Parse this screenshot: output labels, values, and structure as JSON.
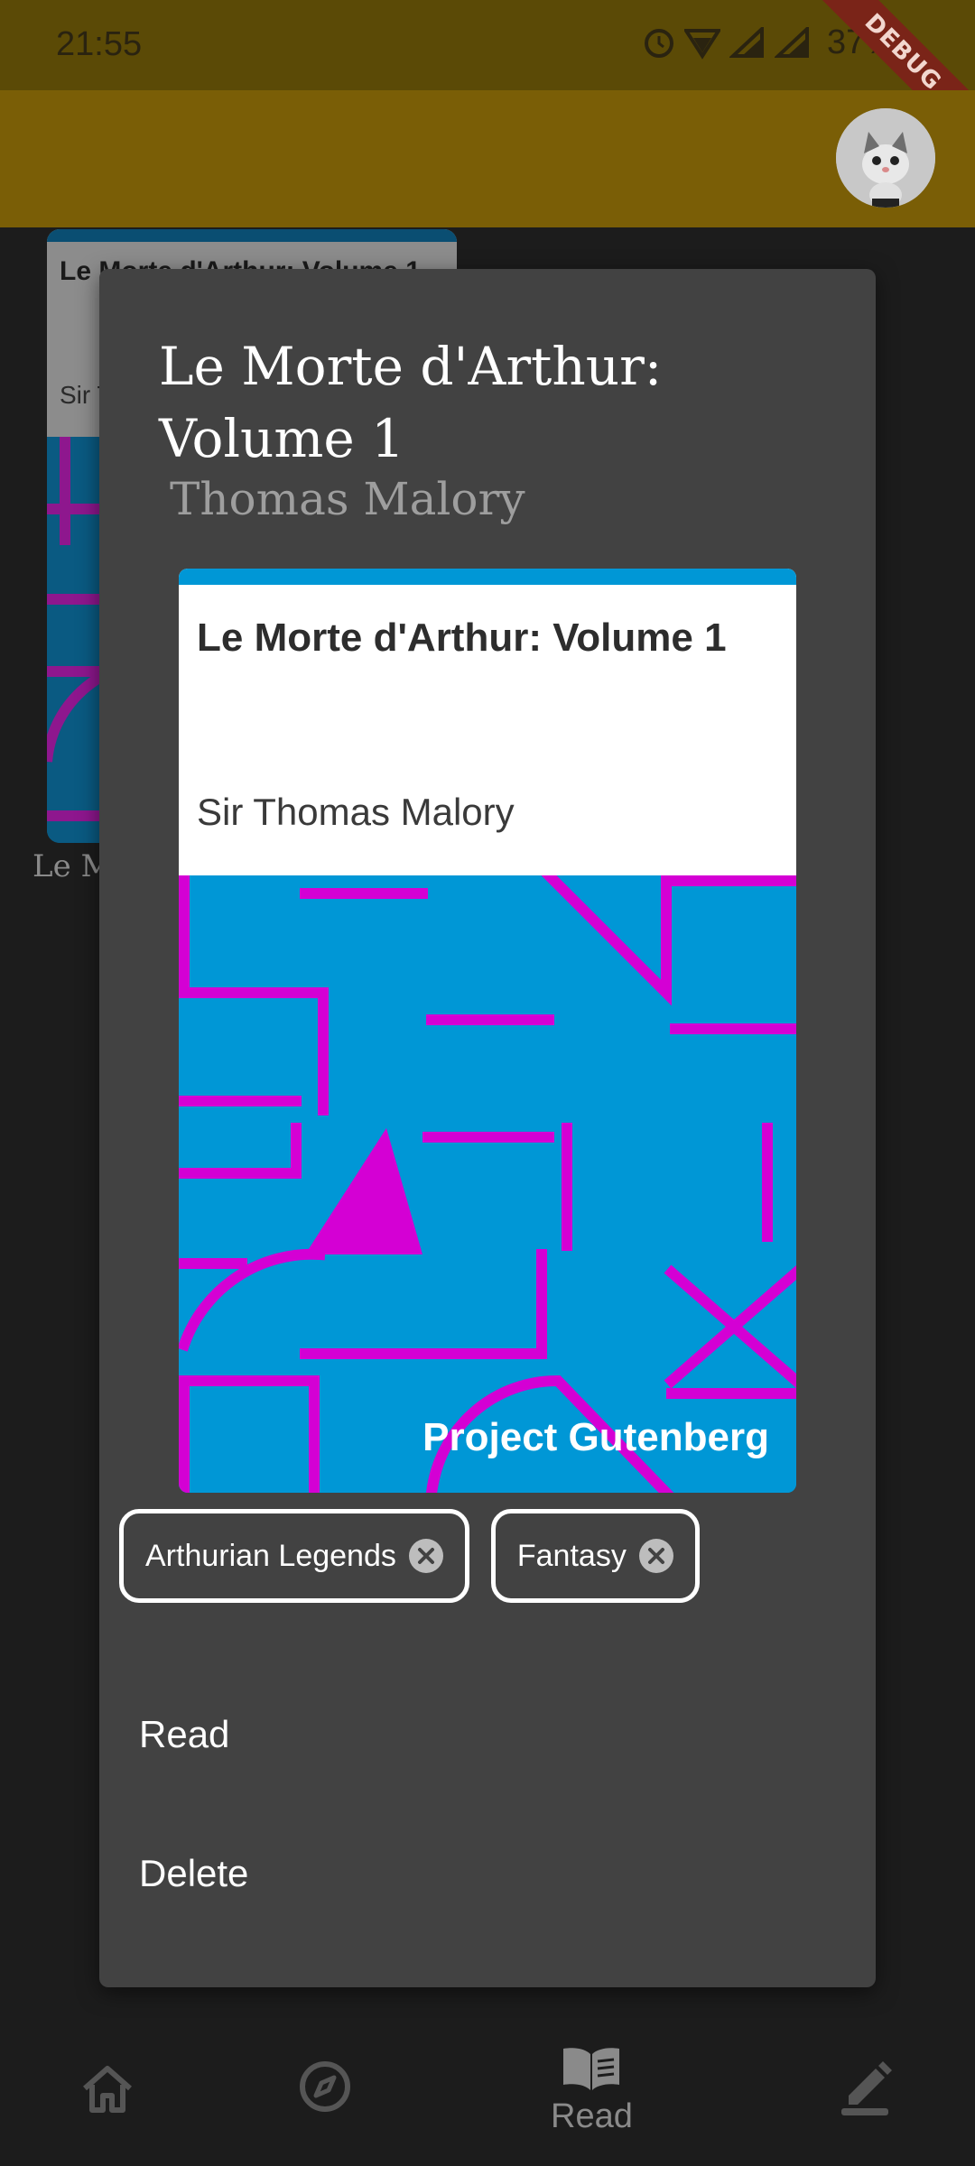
{
  "status_bar": {
    "time": "21:55",
    "battery": "37%",
    "debug_label": "DEBUG"
  },
  "background_card": {
    "cover_title": "Le Morte d'Arthur: Volume 1",
    "cover_author": "Sir Thomas Malory",
    "caption": "Le M"
  },
  "dialog": {
    "title": "Le Morte d'Arthur: Volume 1",
    "author": "Thomas Malory",
    "cover": {
      "title": "Le Morte d'Arthur: Volume 1",
      "author": "Sir Thomas Malory",
      "publisher": "Project Gutenberg"
    },
    "tags": [
      {
        "label": "Arthurian Legends"
      },
      {
        "label": "Fantasy"
      }
    ],
    "actions": {
      "read": "Read",
      "delete": "Delete"
    }
  },
  "bottom_nav": {
    "items": [
      {
        "icon": "home-icon",
        "label": ""
      },
      {
        "icon": "compass-icon",
        "label": ""
      },
      {
        "icon": "book-open-icon",
        "label": "Read"
      },
      {
        "icon": "edit-icon",
        "label": ""
      }
    ]
  },
  "colors": {
    "status_bar": "#5b4a06",
    "app_bar": "#7a5e06",
    "dialog": "#424242",
    "cover_blue": "#0097d6",
    "cover_magenta": "#d400d4"
  }
}
